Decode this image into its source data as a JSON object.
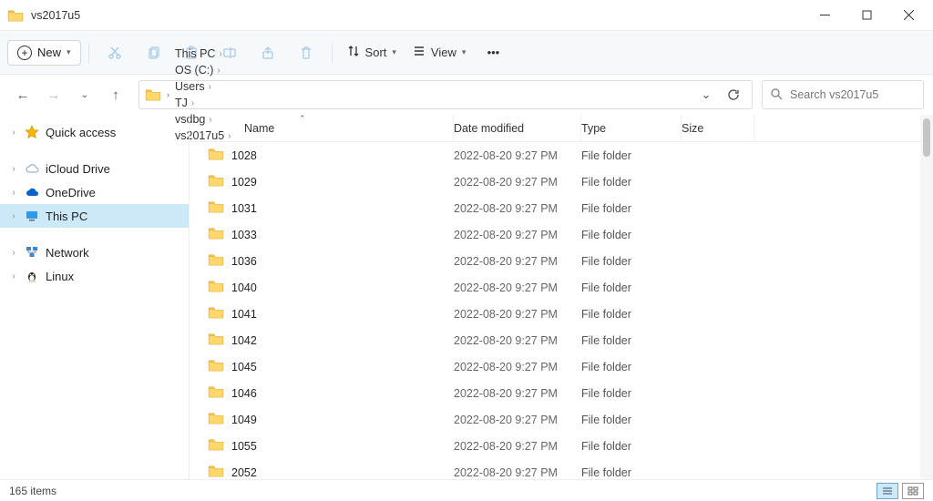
{
  "window": {
    "title": "vs2017u5"
  },
  "toolbar": {
    "new": "New",
    "sort": "Sort",
    "view": "View"
  },
  "breadcrumbs": [
    "This PC",
    "OS (C:)",
    "Users",
    "TJ",
    "vsdbg",
    "vs2017u5"
  ],
  "search": {
    "placeholder": "Search vs2017u5"
  },
  "sidebar": [
    {
      "label": "Quick access",
      "icon": "star"
    },
    {
      "label": "iCloud Drive",
      "icon": "icloud"
    },
    {
      "label": "OneDrive",
      "icon": "onedrive"
    },
    {
      "label": "This PC",
      "icon": "pc",
      "selected": true
    },
    {
      "label": "Network",
      "icon": "network"
    },
    {
      "label": "Linux",
      "icon": "linux"
    }
  ],
  "columns": {
    "name": "Name",
    "date": "Date modified",
    "type": "Type",
    "size": "Size"
  },
  "items": [
    {
      "name": "1028",
      "date": "2022-08-20 9:27 PM",
      "type": "File folder"
    },
    {
      "name": "1029",
      "date": "2022-08-20 9:27 PM",
      "type": "File folder"
    },
    {
      "name": "1031",
      "date": "2022-08-20 9:27 PM",
      "type": "File folder"
    },
    {
      "name": "1033",
      "date": "2022-08-20 9:27 PM",
      "type": "File folder"
    },
    {
      "name": "1036",
      "date": "2022-08-20 9:27 PM",
      "type": "File folder"
    },
    {
      "name": "1040",
      "date": "2022-08-20 9:27 PM",
      "type": "File folder"
    },
    {
      "name": "1041",
      "date": "2022-08-20 9:27 PM",
      "type": "File folder"
    },
    {
      "name": "1042",
      "date": "2022-08-20 9:27 PM",
      "type": "File folder"
    },
    {
      "name": "1045",
      "date": "2022-08-20 9:27 PM",
      "type": "File folder"
    },
    {
      "name": "1046",
      "date": "2022-08-20 9:27 PM",
      "type": "File folder"
    },
    {
      "name": "1049",
      "date": "2022-08-20 9:27 PM",
      "type": "File folder"
    },
    {
      "name": "1055",
      "date": "2022-08-20 9:27 PM",
      "type": "File folder"
    },
    {
      "name": "2052",
      "date": "2022-08-20 9:27 PM",
      "type": "File folder"
    }
  ],
  "status": {
    "count": "165 items"
  }
}
